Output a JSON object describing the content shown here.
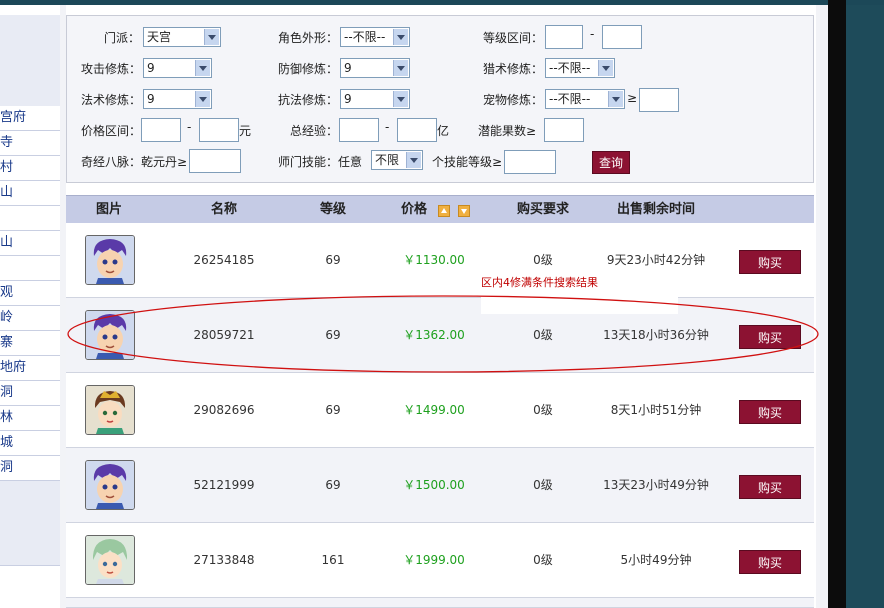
{
  "left_nav": {
    "items": [
      "宫府",
      "寺",
      "村",
      "山",
      "",
      "山",
      "",
      "观",
      "岭",
      "寨",
      "地府",
      "洞",
      "林",
      "城",
      "洞"
    ]
  },
  "filter": {
    "sect_label": "门派：",
    "sect_value": "天宫",
    "appearance_label": "角色外形：",
    "appearance_value": "--不限--",
    "level_range_label": "等级区间：",
    "dash": "-",
    "attack_label": "攻击修炼：",
    "attack_value": "9",
    "defense_label": "防御修炼：",
    "defense_value": "9",
    "hunt_label": "猎术修炼：",
    "hunt_value": "--不限--",
    "magic_label": "法术修炼：",
    "magic_value": "9",
    "resist_label": "抗法修炼：",
    "resist_value": "9",
    "pet_label": "宠物修炼：",
    "pet_value": "--不限--",
    "gte": "≥",
    "price_label": "价格区间：",
    "price_unit": "元",
    "exp_label": "总经验：",
    "exp_unit": "亿",
    "potential_label": "潜能果数≥",
    "meridian_label": "奇经八脉：",
    "meridian_item": "乾元丹≥",
    "skill_label": "师门技能：任意",
    "skill_value": "不限",
    "skill_level_label": "个技能等级≥",
    "search_button": "查询"
  },
  "table": {
    "headers": {
      "image": "图片",
      "name": "名称",
      "level": "等级",
      "price": "价格",
      "req": "购买要求",
      "time": "出售剩余时间"
    },
    "buy_label": "购买",
    "rows": [
      {
        "name": "26254185",
        "level": "69",
        "price": "￥1130.00",
        "req": "0级",
        "time": "9天23小时42分钟",
        "avatar": "boy-purple-hair"
      },
      {
        "name": "28059721",
        "level": "69",
        "price": "￥1362.00",
        "req": "0级",
        "time": "13天18小时36分钟",
        "avatar": "boy-purple-hair"
      },
      {
        "name": "29082696",
        "level": "69",
        "price": "￥1499.00",
        "req": "0级",
        "time": "8天1小时51分钟",
        "avatar": "girl-gold-crown"
      },
      {
        "name": "52121999",
        "level": "69",
        "price": "￥1500.00",
        "req": "0级",
        "time": "13天23小时49分钟",
        "avatar": "boy-purple-hair"
      },
      {
        "name": "27133848",
        "level": "161",
        "price": "￥1999.00",
        "req": "0级",
        "time": "5小时49分钟",
        "avatar": "boy-green-hair"
      }
    ]
  },
  "annotation": {
    "text": "区内4修满条件搜索结果",
    "color": "#cc0000"
  },
  "colors": {
    "accent": "#8c1232",
    "price": "#1ea01e",
    "header_bg": "#c5cbe5"
  }
}
